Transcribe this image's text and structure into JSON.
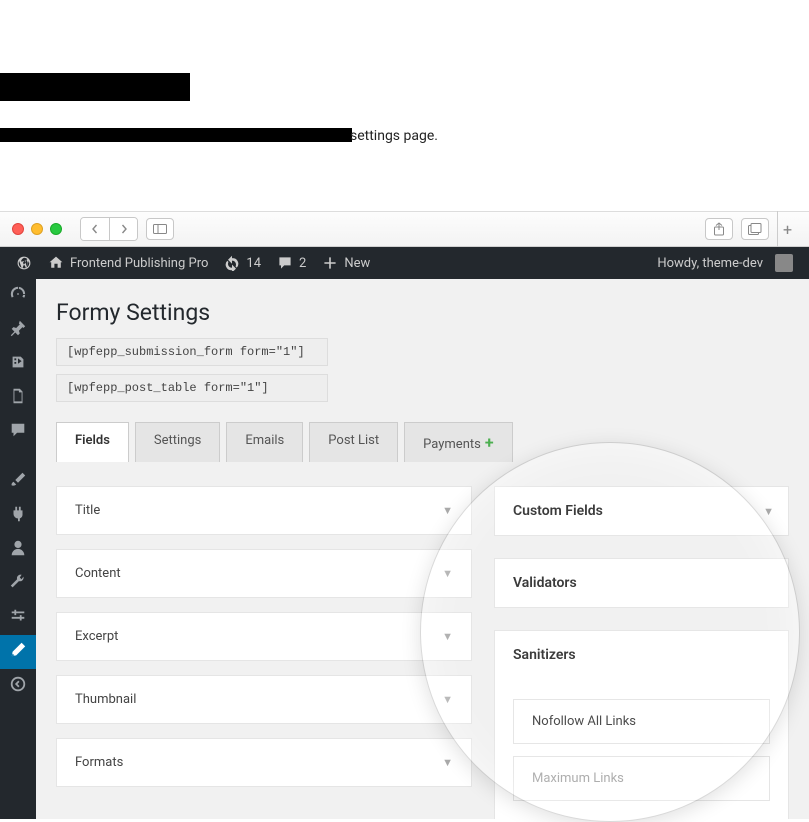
{
  "header": {
    "subtitle_fragment": "settings page."
  },
  "adminbar": {
    "site_name": "Frontend Publishing Pro",
    "updates": "14",
    "comments": "2",
    "new_label": "New",
    "howdy": "Howdy, theme-dev"
  },
  "page": {
    "title": "Formy Settings",
    "shortcode1": "[wpfepp_submission_form form=\"1\"]",
    "shortcode2": "[wpfepp_post_table form=\"1\"]"
  },
  "tabs": [
    {
      "label": "Fields",
      "active": true
    },
    {
      "label": "Settings",
      "active": false
    },
    {
      "label": "Emails",
      "active": false
    },
    {
      "label": "Post List",
      "active": false
    },
    {
      "label": "Payments",
      "active": false
    }
  ],
  "fields": [
    {
      "label": "Title"
    },
    {
      "label": "Content"
    },
    {
      "label": "Excerpt"
    },
    {
      "label": "Thumbnail"
    },
    {
      "label": "Formats"
    }
  ],
  "panels": {
    "custom_fields": "Custom Fields",
    "validators": "Validators",
    "sanitizers": "Sanitizers",
    "sanitizer_items": [
      {
        "label": "Nofollow All Links"
      },
      {
        "label": "Maximum Links"
      }
    ]
  }
}
